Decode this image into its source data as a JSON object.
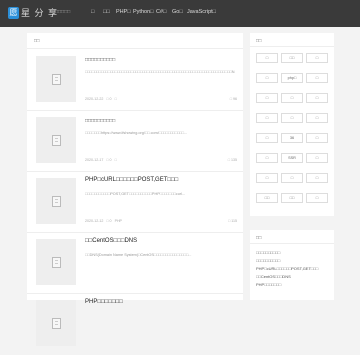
{
  "header": {
    "logo_badge": "愿",
    "logo_text": "星 分 享",
    "subtitle": "□□□□□□",
    "nav": [
      "□",
      "□□",
      "PHP□",
      "Python□",
      "C#□",
      "Go□",
      "JavaScript□"
    ]
  },
  "main": {
    "section_title": "□□",
    "posts": [
      {
        "title": "□□□□□□□□□□",
        "excerpt": "□□□□□□□□□□□□□□□□□□□□□□□□□□□□□□□□□□□□□□□□□□□□□□□□□□□□□□□□□□□□□□□□N...",
        "date": "2020-12-22",
        "comments": "□ 0",
        "category": "□",
        "views": "□ 96"
      },
      {
        "title": "□□□□□□□□□□",
        "excerpt": "□□□□□□□https://www.ifshowing.org/□□.com/□□□□□□□□□□□...",
        "date": "2020-12-17",
        "comments": "□ 0",
        "category": "□",
        "views": "□ 135"
      },
      {
        "title": "PHP□cURL□□□□□□POST,GET□□□",
        "excerpt": "□□□□□□□□□□□POST,GET□□□□□□□□□□PHP□□□□□□□curl...",
        "date": "2020-12-12",
        "comments": "□ 0",
        "category": "PHP",
        "views": "□ 115"
      },
      {
        "title": "□□CentOS□□□DNS",
        "excerpt": "□□DNS(Domain Name System)□CentOS□□□□□□□□□□□□□□□...",
        "date": "",
        "comments": "",
        "category": "",
        "views": ""
      },
      {
        "title": "PHP□□□□□□□",
        "excerpt": "",
        "date": "",
        "comments": "",
        "category": "",
        "views": ""
      }
    ]
  },
  "sidebar": {
    "tags_title": "□□",
    "tags": [
      "□",
      "□□",
      "□",
      "□",
      "php□",
      "□",
      "□",
      "□",
      "□",
      "□",
      "□",
      "□",
      "□",
      "36",
      "□",
      "□",
      "SSR",
      "□",
      "□",
      "□",
      "□",
      "□□",
      "□□",
      "□"
    ],
    "recent_title": "□□",
    "recent": [
      "□□□□□□□□□□",
      "□□□□□□□□□□",
      "PHP□cURL□□□□□□POST,GET□□□",
      "□□CentOS□□□DNS",
      "PHP□□□□□□□"
    ]
  }
}
